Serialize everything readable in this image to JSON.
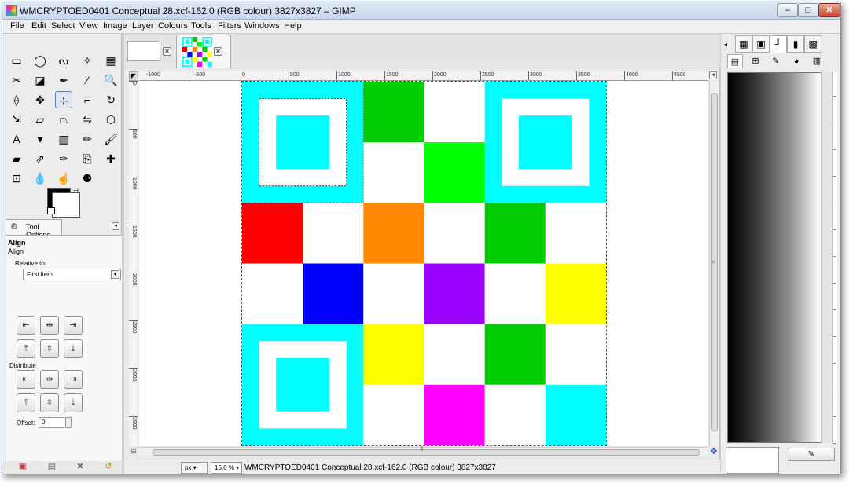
{
  "window": {
    "title": "WMCRYPTOED0401 Conceptual 28.xcf-162.0 (RGB colour) 3827x3827 – GIMP",
    "minimize_icon": "minimize-icon",
    "maximize_icon": "maximize-icon",
    "close_icon": "close-icon"
  },
  "menus": [
    "File",
    "Edit",
    "Select",
    "View",
    "Image",
    "Layer",
    "Colours",
    "Tools",
    "Filters",
    "Windows",
    "Help"
  ],
  "toolbox": {
    "tools": [
      {
        "name": "rect-select-tool",
        "glyph": "▭"
      },
      {
        "name": "ellipse-select-tool",
        "glyph": "◯"
      },
      {
        "name": "free-select-tool",
        "glyph": "ᔓ"
      },
      {
        "name": "fuzzy-select-tool",
        "glyph": "✧"
      },
      {
        "name": "select-by-colour-tool",
        "glyph": "▦"
      },
      {
        "name": "scissors-select-tool",
        "glyph": "✂"
      },
      {
        "name": "foreground-select-tool",
        "glyph": "◪"
      },
      {
        "name": "paths-tool",
        "glyph": "✒"
      },
      {
        "name": "colour-picker-tool",
        "glyph": "⁄"
      },
      {
        "name": "zoom-tool",
        "glyph": "🔍"
      },
      {
        "name": "measure-tool",
        "glyph": "⟠"
      },
      {
        "name": "move-tool",
        "glyph": "✥"
      },
      {
        "name": "align-tool",
        "glyph": "⊹",
        "active": true
      },
      {
        "name": "crop-tool",
        "glyph": "⌐"
      },
      {
        "name": "rotate-tool",
        "glyph": "↻"
      },
      {
        "name": "scale-tool",
        "glyph": "⇲"
      },
      {
        "name": "shear-tool",
        "glyph": "▱"
      },
      {
        "name": "perspective-tool",
        "glyph": "⏢"
      },
      {
        "name": "flip-tool",
        "glyph": "⇋"
      },
      {
        "name": "cage-transform-tool",
        "glyph": "⬡"
      },
      {
        "name": "text-tool",
        "glyph": "A"
      },
      {
        "name": "bucket-fill-tool",
        "glyph": "▾"
      },
      {
        "name": "blend-tool",
        "glyph": "▥"
      },
      {
        "name": "pencil-tool",
        "glyph": "✏"
      },
      {
        "name": "paintbrush-tool",
        "glyph": "🖌"
      },
      {
        "name": "eraser-tool",
        "glyph": "▰"
      },
      {
        "name": "airbrush-tool",
        "glyph": "⇗"
      },
      {
        "name": "ink-tool",
        "glyph": "✑"
      },
      {
        "name": "clone-tool",
        "glyph": "⎘"
      },
      {
        "name": "heal-tool",
        "glyph": "✚"
      },
      {
        "name": "perspective-clone-tool",
        "glyph": "⊡"
      },
      {
        "name": "blur-tool",
        "glyph": "💧"
      },
      {
        "name": "smudge-tool",
        "glyph": "☝"
      },
      {
        "name": "dodge-burn-tool",
        "glyph": "⚈"
      }
    ],
    "tool_options_tab": "Tool Options",
    "tool_name": "Align",
    "tool_sub": "Align",
    "relative_label": "Relative to:",
    "relative_value": "First item",
    "distribute_label": "Distribute",
    "offset_label": "Offset:",
    "offset_value": "0",
    "align_buttons": [
      {
        "name": "align-left-edge-button",
        "glyph": "⇤"
      },
      {
        "name": "align-center-horizontal-button",
        "glyph": "⇹"
      },
      {
        "name": "align-right-edge-button",
        "glyph": "⇥"
      },
      {
        "name": "align-top-edge-button",
        "glyph": "⤒"
      },
      {
        "name": "align-middle-vertical-button",
        "glyph": "⇳"
      },
      {
        "name": "align-bottom-edge-button",
        "glyph": "⤓"
      }
    ],
    "distribute_buttons": [
      {
        "name": "distribute-left-edges-button",
        "glyph": "⇤"
      },
      {
        "name": "distribute-centers-horizontal-button",
        "glyph": "⇹"
      },
      {
        "name": "distribute-right-edges-button",
        "glyph": "⇥"
      },
      {
        "name": "distribute-top-edges-button",
        "glyph": "⤒"
      },
      {
        "name": "distribute-middles-vertical-button",
        "glyph": "⇳"
      },
      {
        "name": "distribute-bottom-edges-button",
        "glyph": "⤓"
      }
    ],
    "footer_icons": [
      "save-options-icon",
      "restore-options-icon",
      "delete-options-icon",
      "reset-options-icon"
    ]
  },
  "image": {
    "ruler_h_labels": [
      "-1000",
      "-500",
      "0",
      "500",
      "1000",
      "1500",
      "2000",
      "2500",
      "3000",
      "3500",
      "4000",
      "4500"
    ],
    "ruler_v_labels": [
      "0",
      "500",
      "1000",
      "1500",
      "2000",
      "2500",
      "3000",
      "3500"
    ],
    "unit": "px",
    "zoom": "15.6 %",
    "status": "WMCRYPTOED0401 Conceptual 28.xcf-162.0 (RGB colour) 3827x3827",
    "grid_rows": [
      [
        "finder",
        "finder",
        "#00cc00",
        "#ffffff",
        "finder",
        "finder"
      ],
      [
        "finder",
        "finder",
        "#ffffff",
        "#00ff00",
        "finder",
        "finder"
      ],
      [
        "#ff0000",
        "#ffffff",
        "#ff8800",
        "#ffffff",
        "#00cc00",
        "#ffffff"
      ],
      [
        "#ffffff",
        "#0000ff",
        "#ffffff",
        "#9900ff",
        "#ffffff",
        "#ffff00"
      ],
      [
        "finder",
        "finder",
        "#ffff00",
        "#ffffff",
        "#00cc00",
        "#ffffff"
      ],
      [
        "finder",
        "finder",
        "#ffffff",
        "#ff00ff",
        "#ffffff",
        "#00ffff"
      ]
    ],
    "finder_color": "#00ffff"
  },
  "dock": {
    "top_tabs": [
      "patterns-icon",
      "brush-tab-icon",
      "brush-shape-icon",
      "gradient-icon",
      "palette-icon"
    ],
    "top_tab_glyphs": [
      "▦",
      "▣",
      "┘",
      "▮",
      "▩"
    ],
    "second_tabs": [
      "layers-icon",
      "channels-icon",
      "paths-icon",
      "colormap-icon",
      "histogram-icon"
    ],
    "second_tab_glyphs": [
      "▤",
      "⊞",
      "✎",
      "◕",
      "▥"
    ],
    "bottom_button_icon": "edit-brush-icon"
  }
}
